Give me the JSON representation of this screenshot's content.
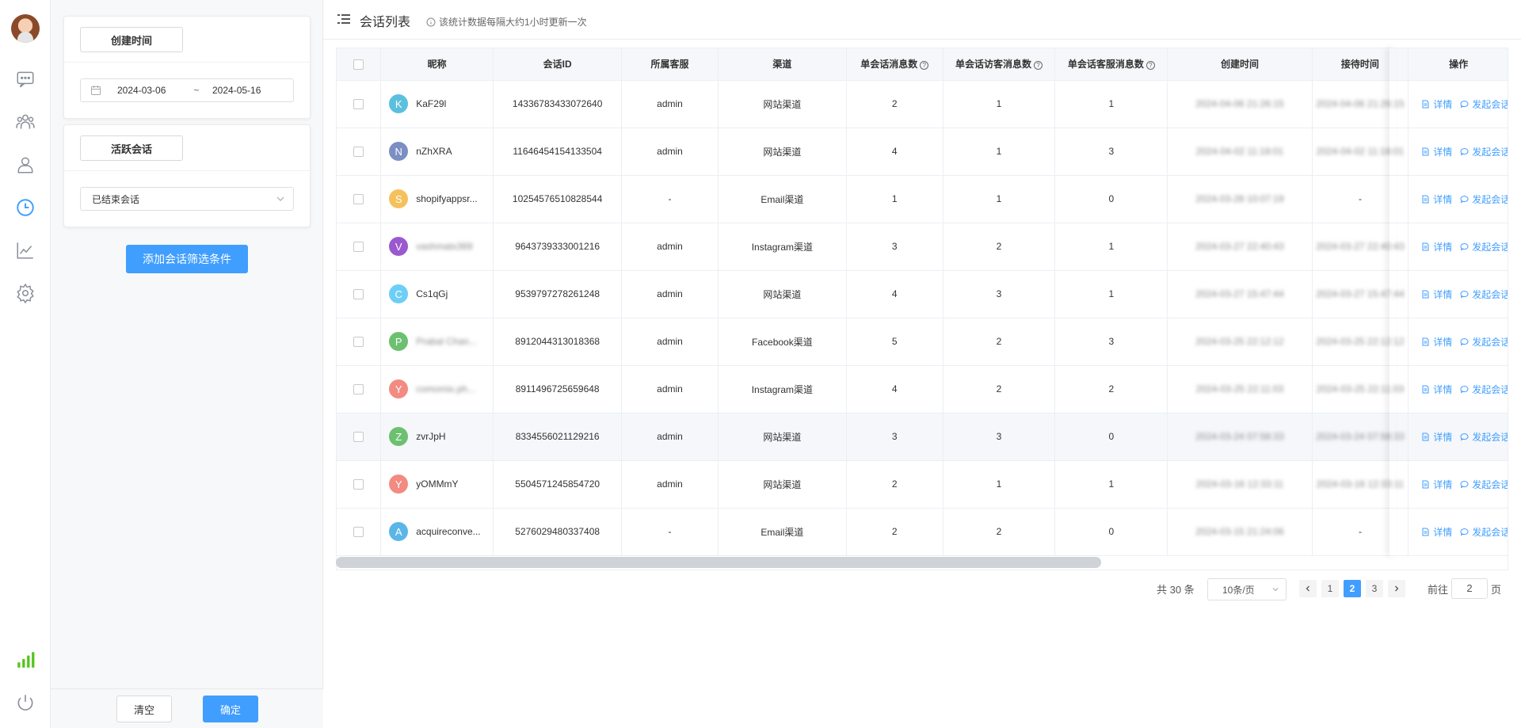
{
  "rail": {
    "icons": [
      "chat-icon",
      "team-icon",
      "user-icon",
      "clock-icon",
      "chart-icon",
      "gear-icon"
    ],
    "active": "clock-icon",
    "signal_color": "#52c41a"
  },
  "filter": {
    "created_time": {
      "label": "创建时间",
      "start": "2024-03-06",
      "separator": "~",
      "end": "2024-05-16"
    },
    "active_session": {
      "label": "活跃会话",
      "selected": "已结束会话"
    },
    "add_condition_label": "添加会话筛选条件",
    "clear_label": "清空",
    "confirm_label": "确定"
  },
  "header": {
    "title": "会话列表",
    "info": "该统计数据每隔大约1小时更新一次"
  },
  "table": {
    "columns": {
      "nickname": "昵称",
      "session_id": "会话ID",
      "agent": "所属客服",
      "channel": "渠道",
      "msg_count": "单会话消息数",
      "visitor_msg": "单会话访客消息数",
      "agent_msg": "单会话客服消息数",
      "created": "创建时间",
      "reception": "接待时间",
      "actions": "操作"
    },
    "action_labels": {
      "detail": "详情",
      "start_chat": "发起会话"
    },
    "rows": [
      {
        "initial": "K",
        "color": "#5bc0de",
        "nickname": "KaF29l",
        "blurred": false,
        "session_id": "14336783433072640",
        "agent": "admin",
        "channel": "网站渠道",
        "msg": "2",
        "visitor": "1",
        "agent_msg": "1",
        "created": "2024-04-06 21:26:15",
        "reception": "2024-04-06 21:26:15"
      },
      {
        "initial": "N",
        "color": "#7b8fc4",
        "nickname": "nZhXRA",
        "blurred": false,
        "session_id": "11646454154133504",
        "agent": "admin",
        "channel": "网站渠道",
        "msg": "4",
        "visitor": "1",
        "agent_msg": "3",
        "created": "2024-04-02 11:18:01",
        "reception": "2024-04-02 11:18:01"
      },
      {
        "initial": "S",
        "color": "#f5c15c",
        "nickname": "shopifyappsr...",
        "blurred": false,
        "session_id": "10254576510828544",
        "agent": "-",
        "channel": "Email渠道",
        "msg": "1",
        "visitor": "1",
        "agent_msg": "0",
        "created": "2024-03-28 10:07:19",
        "reception": "-"
      },
      {
        "initial": "V",
        "color": "#9b59d0",
        "nickname": "vashmatx369",
        "blurred": true,
        "session_id": "9643739333001216",
        "agent": "admin",
        "channel": "Instagram渠道",
        "msg": "3",
        "visitor": "2",
        "agent_msg": "1",
        "created": "2024-03-27 22:40:43",
        "reception": "2024-03-27 22:40:43"
      },
      {
        "initial": "C",
        "color": "#6ccff6",
        "nickname": "Cs1qGj",
        "blurred": false,
        "session_id": "9539797278261248",
        "agent": "admin",
        "channel": "网站渠道",
        "msg": "4",
        "visitor": "3",
        "agent_msg": "1",
        "created": "2024-03-27 15:47:44",
        "reception": "2024-03-27 15:47:44"
      },
      {
        "initial": "P",
        "color": "#6cc070",
        "nickname": "Prabal Chan...",
        "blurred": true,
        "session_id": "8912044313018368",
        "agent": "admin",
        "channel": "Facebook渠道",
        "msg": "5",
        "visitor": "2",
        "agent_msg": "3",
        "created": "2024-03-25 22:12:12",
        "reception": "2024-03-25 22:12:12"
      },
      {
        "initial": "Y",
        "color": "#f28b82",
        "nickname": "comomix.ph...",
        "blurred": true,
        "session_id": "8911496725659648",
        "agent": "admin",
        "channel": "Instagram渠道",
        "msg": "4",
        "visitor": "2",
        "agent_msg": "2",
        "created": "2024-03-25 22:11:03",
        "reception": "2024-03-25 22:11:03"
      },
      {
        "initial": "Z",
        "color": "#6cc070",
        "nickname": "zvrJpH",
        "blurred": false,
        "session_id": "8334556021129216",
        "agent": "admin",
        "channel": "网站渠道",
        "msg": "3",
        "visitor": "3",
        "agent_msg": "0",
        "created": "2024-03-24 07:58:33",
        "reception": "2024-03-24 07:58:33"
      },
      {
        "initial": "Y",
        "color": "#f28b82",
        "nickname": "yOMMmY",
        "blurred": false,
        "session_id": "5504571245854720",
        "agent": "admin",
        "channel": "网站渠道",
        "msg": "2",
        "visitor": "1",
        "agent_msg": "1",
        "created": "2024-03-16 12:33:11",
        "reception": "2024-03-16 12:33:11"
      },
      {
        "initial": "A",
        "color": "#5bb6e8",
        "nickname": "acquireconve...",
        "blurred": false,
        "session_id": "5276029480337408",
        "agent": "-",
        "channel": "Email渠道",
        "msg": "2",
        "visitor": "2",
        "agent_msg": "0",
        "created": "2024-03-15 21:24:06",
        "reception": "-"
      }
    ]
  },
  "pagination": {
    "total": "共 30 条",
    "page_size": "10条/页",
    "pages": [
      "1",
      "2",
      "3"
    ],
    "current": "2",
    "goto_label": "前往",
    "goto_value": "2",
    "page_unit": "页"
  },
  "colors": {
    "accent": "#409eff",
    "header_bg": "#f5f7fa"
  }
}
